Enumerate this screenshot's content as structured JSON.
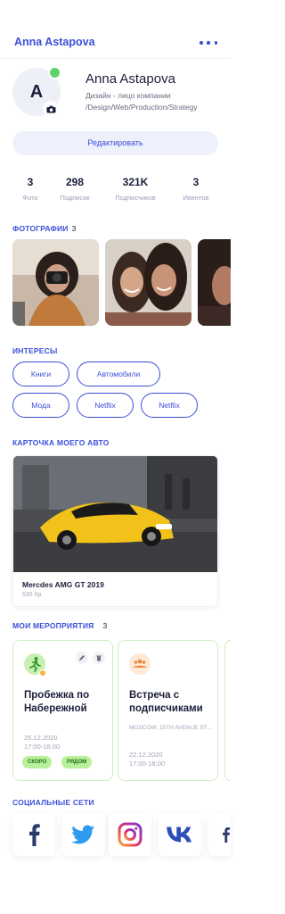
{
  "header": {
    "title": "Anna Astapova",
    "more_icon": "more-dots-icon"
  },
  "profile": {
    "avatar_letter": "A",
    "name": "Anna Astapova",
    "bio": "Дизайн - лицо компании /Design/Web/Production/Strategy",
    "edit_label": "Редактировать"
  },
  "stats": [
    {
      "value": "3",
      "label": "Фото"
    },
    {
      "value": "298",
      "label": "Подписок"
    },
    {
      "value": "321K",
      "label": "Подписчиков"
    },
    {
      "value": "3",
      "label": "Ивентов"
    }
  ],
  "photos": {
    "title": "ФОТОГРАФИИ",
    "count": "3"
  },
  "interests": {
    "title": "ИНТЕРЕСЫ",
    "items": [
      "Книги",
      "Автомобили",
      "Мода",
      "Netflix",
      "Netflix"
    ]
  },
  "car": {
    "title": "КАРТОЧКА МОЕГО АВТО",
    "name": "Mercdes AMG GT 2019",
    "power": "535 hp"
  },
  "events": {
    "title": "МОИ МЕРОПРИЯТИЯ",
    "count": "3",
    "items": [
      {
        "title": "Пробежка по Набережной",
        "date": "25.12.2020",
        "time": "17:00-18:00",
        "tags": [
          "СКОРО",
          "РЯДОМ"
        ]
      },
      {
        "title": "Встреча с подписчиками",
        "location": "MOSCOW, 15TH AVENUE ST...",
        "date": "22.12.2020",
        "time": "17:00-18:00"
      }
    ]
  },
  "social": {
    "title": "СОЦИАЛЬНЫЕ СЕТИ",
    "items": [
      "facebook-icon",
      "twitter-icon",
      "instagram-icon",
      "vk-icon",
      "facebook-icon"
    ]
  },
  "colors": {
    "accent": "#3b4fd9",
    "online": "#5ed36b",
    "event_border": "#cfeec0",
    "tag_bg": "#b9f09a"
  }
}
